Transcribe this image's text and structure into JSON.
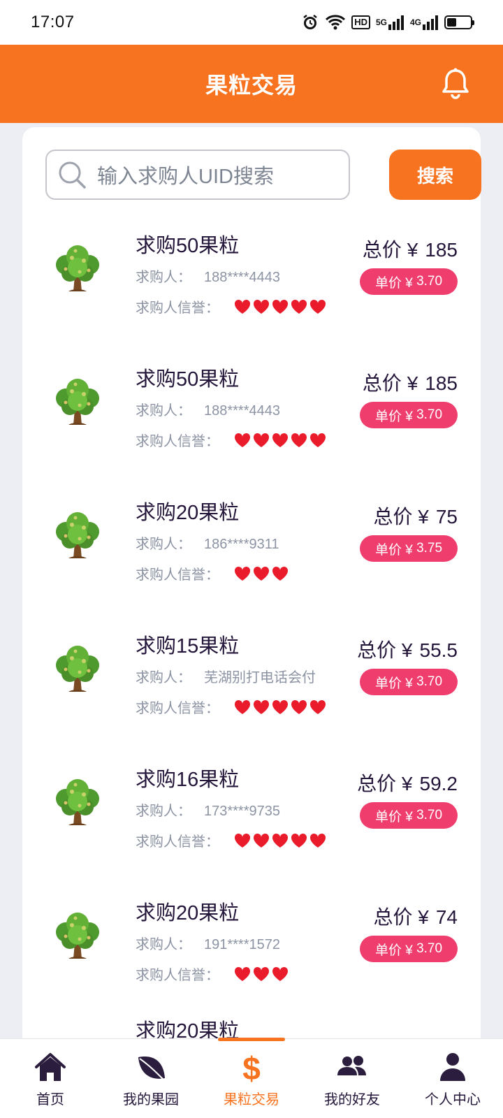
{
  "status_bar": {
    "time": "17:07",
    "hd": "HD",
    "net1": "5G",
    "net2": "4G"
  },
  "header": {
    "title": "果粒交易"
  },
  "search": {
    "placeholder": "输入求购人UID搜索",
    "button_label": "搜索"
  },
  "list": {
    "buyer_label": "求购人：",
    "rep_label": "求购人信誉：",
    "total_label": "总价 ¥",
    "unit_label": "单价 ¥",
    "items": [
      {
        "title": "求购50果粒",
        "buyer": "188****4443",
        "hearts": 5,
        "total": "185",
        "unit": "3.70"
      },
      {
        "title": "求购50果粒",
        "buyer": "188****4443",
        "hearts": 5,
        "total": "185",
        "unit": "3.70"
      },
      {
        "title": "求购20果粒",
        "buyer": "186****9311",
        "hearts": 3,
        "total": "75",
        "unit": "3.75"
      },
      {
        "title": "求购15果粒",
        "buyer": "芜湖别打电话会付",
        "hearts": 5,
        "total": "55.5",
        "unit": "3.70"
      },
      {
        "title": "求购16果粒",
        "buyer": "173****9735",
        "hearts": 5,
        "total": "59.2",
        "unit": "3.70"
      },
      {
        "title": "求购20果粒",
        "buyer": "191****1572",
        "hearts": 3,
        "total": "74",
        "unit": "3.70"
      }
    ],
    "partial_title": "求购20果粒"
  },
  "bottom_nav": {
    "items": [
      {
        "label": "首页",
        "icon": "home-icon"
      },
      {
        "label": "我的果园",
        "icon": "leaf-icon"
      },
      {
        "label": "果粒交易",
        "icon": "dollar-icon"
      },
      {
        "label": "我的好友",
        "icon": "friends-icon"
      },
      {
        "label": "个人中心",
        "icon": "person-icon"
      }
    ],
    "active_index": 2
  },
  "colors": {
    "accent": "#f7731f",
    "badge": "#ef3d6e",
    "heart": "#ea1c2b",
    "text_dark": "#24163a",
    "text_muted": "#8c93a3",
    "background": "#eceef4"
  }
}
